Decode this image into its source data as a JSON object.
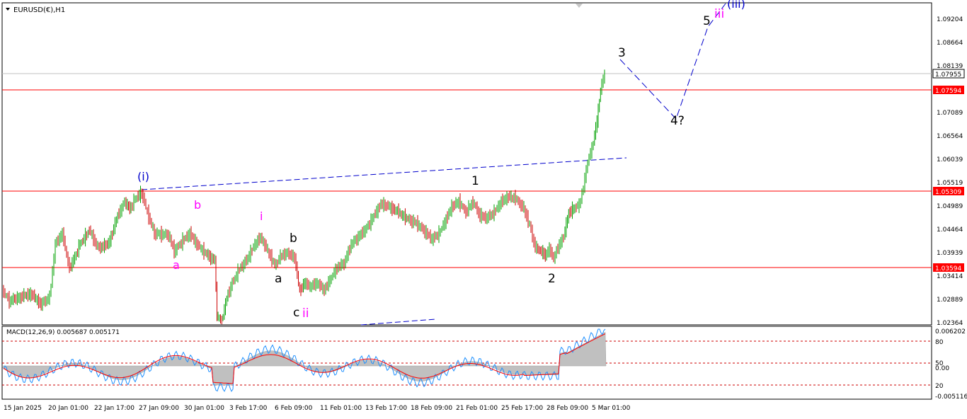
{
  "chart": {
    "symbol_label": "EURUSD(€),H1",
    "current_price": "1.07955",
    "price_axis": [
      "1.09204",
      "1.08664",
      "1.08139",
      "1.07089",
      "1.06564",
      "1.06039",
      "1.05519",
      "1.04989",
      "1.04464",
      "1.03939",
      "1.03414",
      "1.02889",
      "1.02364"
    ],
    "levels": [
      {
        "price": 1.07594,
        "label": "1.07594",
        "color": "#ff0000"
      },
      {
        "price": 1.05309,
        "label": "1.05309",
        "color": "#ff0000"
      },
      {
        "price": 1.03594,
        "label": "1.03594",
        "color": "#ff0000"
      }
    ],
    "time_axis": [
      "15 Jan 2025",
      "20 Jan 01:00",
      "22 Jan 17:00",
      "27 Jan 09:00",
      "30 Jan 01:00",
      "3 Feb 17:00",
      "6 Feb 09:00",
      "11 Feb 01:00",
      "13 Feb 17:00",
      "18 Feb 09:00",
      "21 Feb 01:00",
      "25 Feb 17:00",
      "28 Feb 09:00",
      "5 Mar 01:00"
    ],
    "wave_labels": {
      "i_minor": "(i)",
      "b_pink": "b",
      "a_pink": "a",
      "i_pink": "i",
      "b_black": "b",
      "a_black": "a",
      "c_black": "c",
      "ii_pink": "ii",
      "w1": "1",
      "w2": "2",
      "w3": "3",
      "w4": "4?",
      "w5": "5",
      "iii_pink": "iii",
      "iii_blue": "(iii)"
    }
  },
  "indicator": {
    "label": "MACD(12,26,9) 0.005687 0.005171",
    "axis": [
      "0.006202",
      "80",
      "50",
      "0.00",
      "20",
      "-0.005116"
    ]
  },
  "colors": {
    "bull": "#00a000",
    "bear": "#cc0000",
    "wave_blue": "#0000cc",
    "pink": "#ff00ff",
    "level_red": "#ff0000",
    "macd_signal": "#ff0000",
    "macd_line": "#1e90ff",
    "histogram": "#c0c0c0"
  }
}
